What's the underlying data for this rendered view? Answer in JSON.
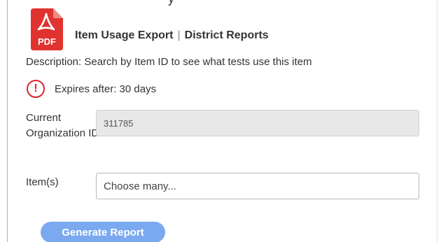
{
  "header": {
    "top_partial_text": "y",
    "icon": "pdf-file-icon",
    "icon_badge_text": "PDF",
    "report_name": "Item Usage Export",
    "separator": "|",
    "category": "District Reports"
  },
  "description": "Description: Search by Item ID to see what tests use this item",
  "expiry": {
    "icon": "alert-circle-icon",
    "icon_glyph": "!",
    "text": "Expires after: 30 days"
  },
  "form": {
    "org_label": "Current Organization ID",
    "org_value": "311785",
    "items_label": "Item(s)",
    "items_placeholder": "Choose many..."
  },
  "actions": {
    "generate_label": "Generate Report"
  },
  "colors": {
    "pdf_red": "#e0322f",
    "alert_red": "#e0242c",
    "button_blue": "#7aa9f0",
    "disabled_input_bg": "#e8e8e8"
  }
}
